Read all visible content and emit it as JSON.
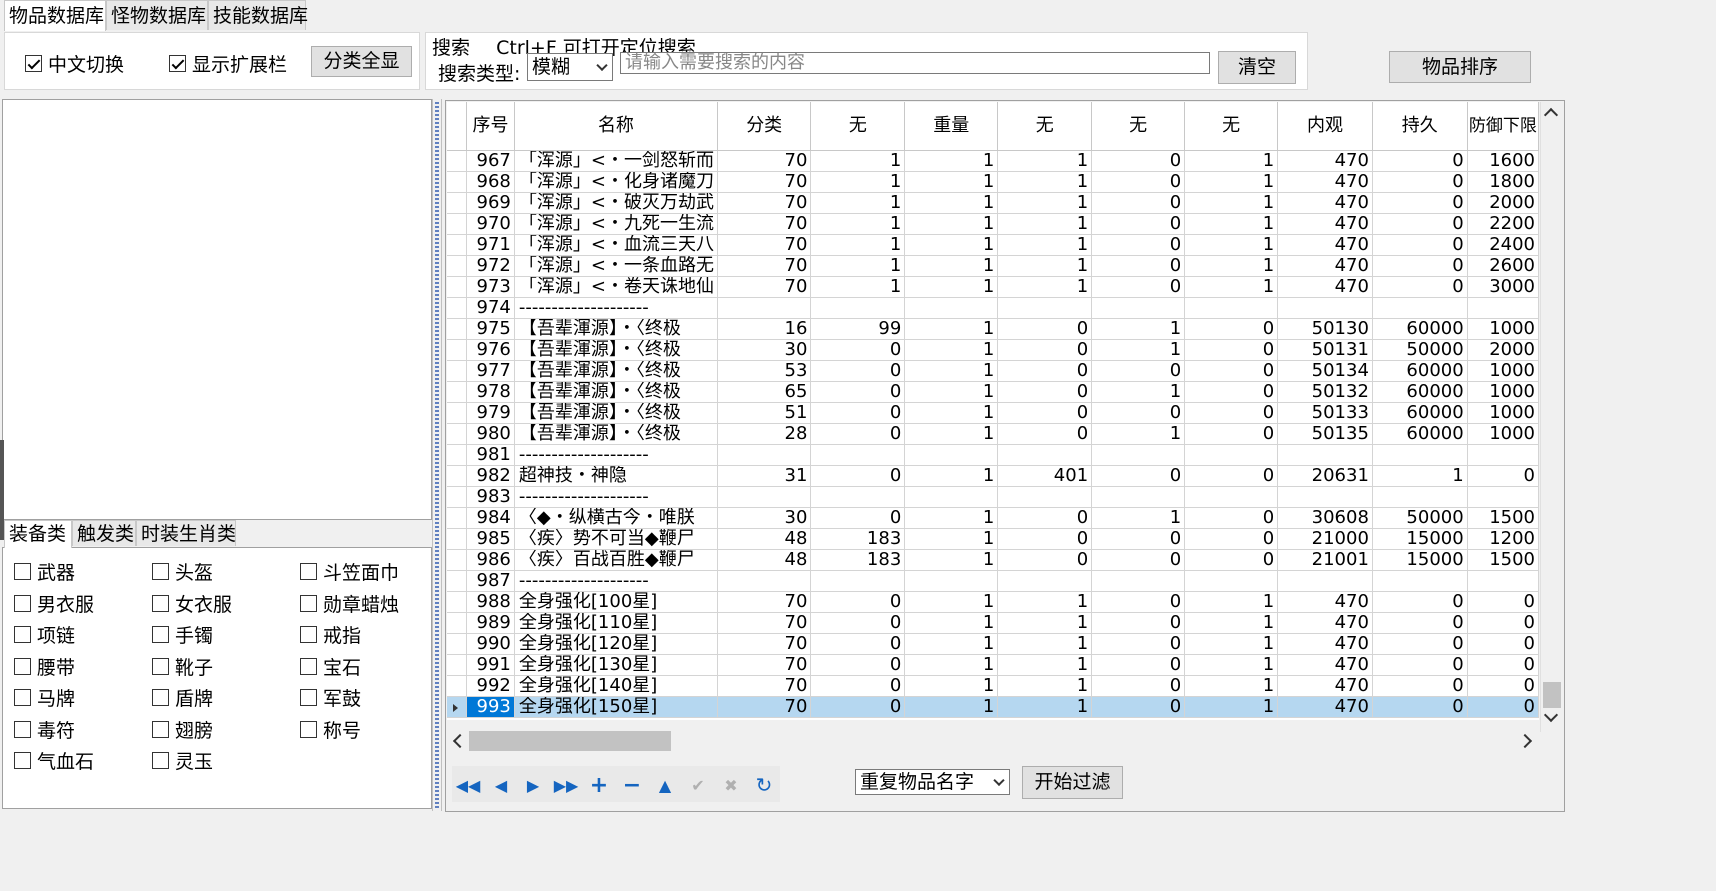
{
  "tabs": [
    "物品数据库",
    "怪物数据库",
    "技能数据库"
  ],
  "toolbar": {
    "chinese_toggle": {
      "label": "中文切换",
      "checked": true
    },
    "show_ext": {
      "label": "显示扩展栏",
      "checked": true
    },
    "show_all_button": "分类全显",
    "search_title": "搜索",
    "search_hint": "Ctrl+F 可打开定位搜索",
    "search_type_label": "搜索类型:",
    "search_type_value": "模糊",
    "search_placeholder": "请输入需要搜索的内容",
    "clear_button": "清空",
    "sort_button": "物品排序"
  },
  "category_tabs": [
    "装备类",
    "触发类",
    "时装生肖类"
  ],
  "categories": [
    [
      "武器",
      "头盔",
      "斗笠面巾"
    ],
    [
      "男衣服",
      "女衣服",
      "勋章蜡烛"
    ],
    [
      "项链",
      "手镯",
      "戒指"
    ],
    [
      "腰带",
      "靴子",
      "宝石"
    ],
    [
      "马牌",
      "盾牌",
      "军鼓"
    ],
    [
      "毒符",
      "翅膀",
      "称号"
    ],
    [
      "气血石",
      "灵玉",
      ""
    ]
  ],
  "grid": {
    "columns": [
      "序号",
      "名称",
      "分类",
      "无",
      "重量",
      "无",
      "无",
      "无",
      "内观",
      "持久",
      "防御下限"
    ],
    "rows": [
      [
        "967",
        "「浑源」<・一剑怒斩而",
        "70",
        "1",
        "1",
        "1",
        "0",
        "1",
        "470",
        "0",
        "1600"
      ],
      [
        "968",
        "「浑源」<・化身诸魔刀",
        "70",
        "1",
        "1",
        "1",
        "0",
        "1",
        "470",
        "0",
        "1800"
      ],
      [
        "969",
        "「浑源」<・破灭万劫武",
        "70",
        "1",
        "1",
        "1",
        "0",
        "1",
        "470",
        "0",
        "2000"
      ],
      [
        "970",
        "「浑源」<・九死一生流",
        "70",
        "1",
        "1",
        "1",
        "0",
        "1",
        "470",
        "0",
        "2200"
      ],
      [
        "971",
        "「浑源」<・血流三天八",
        "70",
        "1",
        "1",
        "1",
        "0",
        "1",
        "470",
        "0",
        "2400"
      ],
      [
        "972",
        "「浑源」<・一条血路无",
        "70",
        "1",
        "1",
        "1",
        "0",
        "1",
        "470",
        "0",
        "2600"
      ],
      [
        "973",
        "「浑源」<・卷天诛地仙",
        "70",
        "1",
        "1",
        "1",
        "0",
        "1",
        "470",
        "0",
        "3000"
      ],
      [
        "974",
        "--------------------",
        "",
        "",
        "",
        "",
        "",
        "",
        "",
        "",
        ""
      ],
      [
        "975",
        "【吾辈渾源】・〈终极",
        "16",
        "99",
        "1",
        "0",
        "1",
        "0",
        "50130",
        "60000",
        "1000"
      ],
      [
        "976",
        "【吾辈渾源】・〈终极",
        "30",
        "0",
        "1",
        "0",
        "1",
        "0",
        "50131",
        "50000",
        "2000"
      ],
      [
        "977",
        "【吾辈渾源】・〈终极",
        "53",
        "0",
        "1",
        "0",
        "0",
        "0",
        "50134",
        "60000",
        "1000"
      ],
      [
        "978",
        "【吾辈渾源】・〈终极",
        "65",
        "0",
        "1",
        "0",
        "1",
        "0",
        "50132",
        "60000",
        "1000"
      ],
      [
        "979",
        "【吾辈渾源】・〈终极",
        "51",
        "0",
        "1",
        "0",
        "0",
        "0",
        "50133",
        "60000",
        "1000"
      ],
      [
        "980",
        "【吾辈渾源】・〈终极",
        "28",
        "0",
        "1",
        "0",
        "1",
        "0",
        "50135",
        "60000",
        "1000"
      ],
      [
        "981",
        "--------------------",
        "",
        "",
        "",
        "",
        "",
        "",
        "",
        "",
        ""
      ],
      [
        "982",
        "超神技・神隐",
        "31",
        "0",
        "1",
        "401",
        "0",
        "0",
        "20631",
        "1",
        "0"
      ],
      [
        "983",
        "--------------------",
        "",
        "",
        "",
        "",
        "",
        "",
        "",
        "",
        ""
      ],
      [
        "984",
        "〈◆・纵横古今・唯朕",
        "30",
        "0",
        "1",
        "0",
        "1",
        "0",
        "30608",
        "50000",
        "1500"
      ],
      [
        "985",
        "〈疾〉势不可当◆鞭尸",
        "48",
        "183",
        "1",
        "0",
        "0",
        "0",
        "21000",
        "15000",
        "1200"
      ],
      [
        "986",
        "〈疾〉百战百胜◆鞭尸",
        "48",
        "183",
        "1",
        "0",
        "0",
        "0",
        "21001",
        "15000",
        "1500"
      ],
      [
        "987",
        "--------------------",
        "",
        "",
        "",
        "",
        "",
        "",
        "",
        "",
        ""
      ],
      [
        "988",
        "全身强化[100星]",
        "70",
        "0",
        "1",
        "1",
        "0",
        "1",
        "470",
        "0",
        "0"
      ],
      [
        "989",
        "全身强化[110星]",
        "70",
        "0",
        "1",
        "1",
        "0",
        "1",
        "470",
        "0",
        "0"
      ],
      [
        "990",
        "全身强化[120星]",
        "70",
        "0",
        "1",
        "1",
        "0",
        "1",
        "470",
        "0",
        "0"
      ],
      [
        "991",
        "全身强化[130星]",
        "70",
        "0",
        "1",
        "1",
        "0",
        "1",
        "470",
        "0",
        "0"
      ],
      [
        "992",
        "全身强化[140星]",
        "70",
        "0",
        "1",
        "1",
        "0",
        "1",
        "470",
        "0",
        "0"
      ],
      [
        "993",
        "全身强化[150星]",
        "70",
        "0",
        "1",
        "1",
        "0",
        "1",
        "470",
        "0",
        "0"
      ]
    ],
    "selected_row": 26
  },
  "footer": {
    "filter_select": "重复物品名字",
    "filter_button": "开始过滤"
  },
  "nav_icons": [
    "first-icon",
    "prev-icon",
    "next-icon",
    "last-icon",
    "add-icon",
    "delete-icon",
    "up-icon",
    "confirm-icon",
    "cancel-icon",
    "refresh-icon"
  ],
  "colors": {
    "selection": "#b5d7f0",
    "selected_index": "#0078d7",
    "nav_icon": "#1565c0"
  }
}
